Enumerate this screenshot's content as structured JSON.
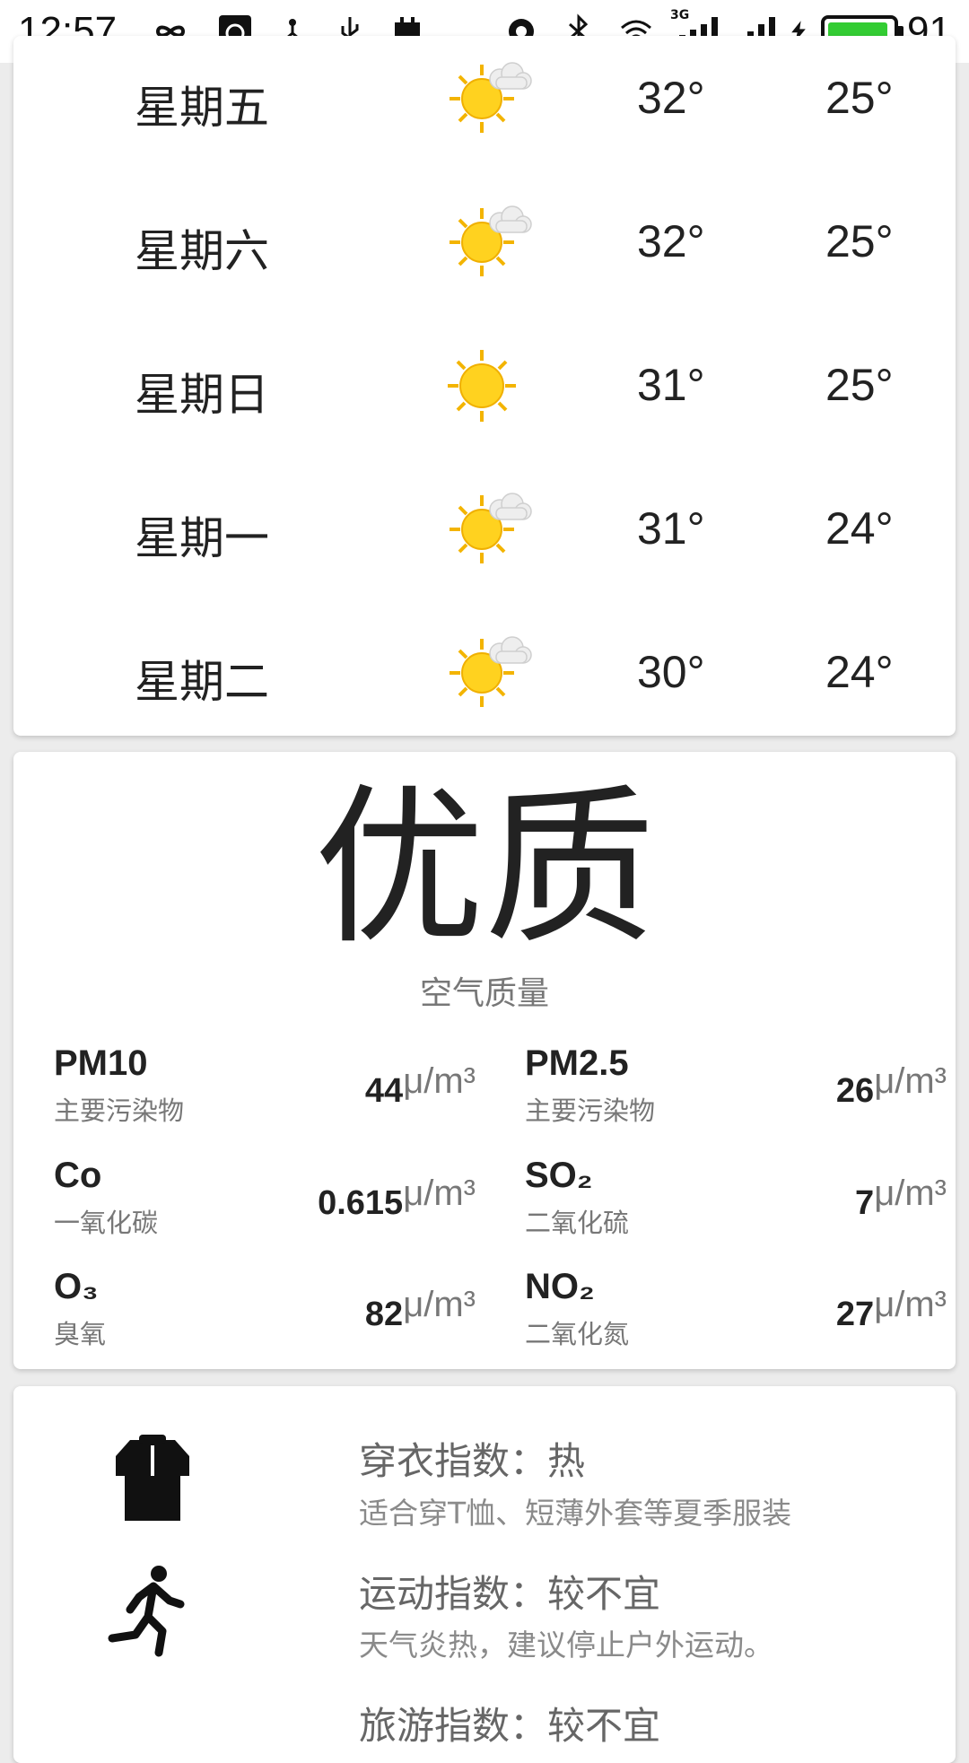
{
  "status_bar": {
    "time": "12:57",
    "left_icons": [
      "infinity-icon",
      "uc-browser-icon",
      "share-node-icon",
      "usb-icon",
      "calendar-icon"
    ],
    "right_icons": [
      "data-saver-icon",
      "bluetooth-icon",
      "wifi-icon",
      "signal-3g-icon",
      "signal-icon",
      "charging-icon"
    ],
    "network_label": "3G",
    "battery_percent": "91",
    "battery_color": "#33cc33"
  },
  "forecast": [
    {
      "day": "星期五",
      "icon": "partly-sunny-icon",
      "high": "32°",
      "low": "25°"
    },
    {
      "day": "星期六",
      "icon": "partly-sunny-icon",
      "high": "32°",
      "low": "25°"
    },
    {
      "day": "星期日",
      "icon": "sunny-icon",
      "high": "31°",
      "low": "25°"
    },
    {
      "day": "星期一",
      "icon": "partly-sunny-icon",
      "high": "31°",
      "low": "24°"
    },
    {
      "day": "星期二",
      "icon": "partly-sunny-icon",
      "high": "30°",
      "low": "24°"
    }
  ],
  "air_quality": {
    "level": "优质",
    "label": "空气质量",
    "unit": "μ/m³",
    "pollutants": [
      {
        "name": "PM10",
        "desc": "主要污染物",
        "value": "44"
      },
      {
        "name": "PM2.5",
        "desc": "主要污染物",
        "value": "26"
      },
      {
        "name": "Co",
        "desc": "一氧化碳",
        "value": "0.615"
      },
      {
        "name": "SO₂",
        "desc": "二氧化硫",
        "value": "7"
      },
      {
        "name": "O₃",
        "desc": "臭氧",
        "value": "82"
      },
      {
        "name": "NO₂",
        "desc": "二氧化氮",
        "value": "27"
      }
    ]
  },
  "lifestyle": [
    {
      "icon": "clothing-icon",
      "title": "穿衣指数：热",
      "desc": "适合穿T恤、短薄外套等夏季服装"
    },
    {
      "icon": "running-icon",
      "title": "运动指数：较不宜",
      "desc": "天气炎热，建议停止户外运动。"
    },
    {
      "icon": "travel-icon",
      "title": "旅游指数：较不宜",
      "desc": ""
    }
  ]
}
